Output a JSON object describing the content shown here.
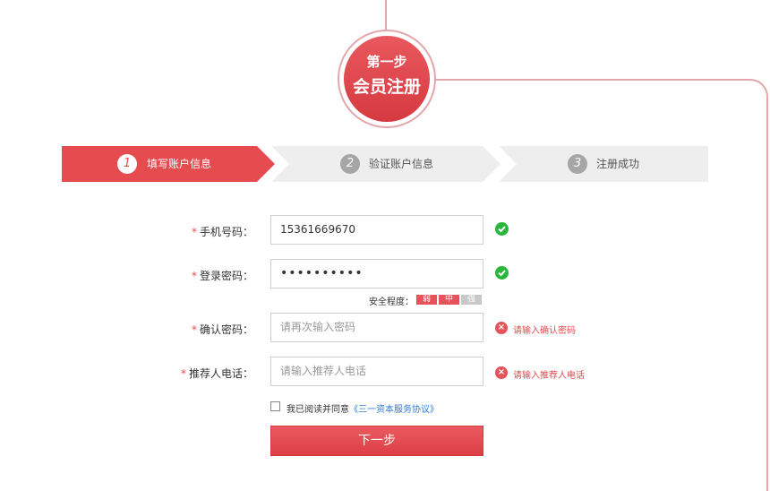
{
  "badge": {
    "line1": "第一步",
    "line2": "会员注册"
  },
  "steps": [
    {
      "number": "1",
      "label": "填写账户信息",
      "active": true
    },
    {
      "number": "2",
      "label": "验证账户信息",
      "active": false
    },
    {
      "number": "3",
      "label": "注册成功",
      "active": false
    }
  ],
  "form": {
    "required_mark": "*",
    "phone": {
      "label": "手机号码：",
      "value": "15361669670"
    },
    "password": {
      "label": "登录密码：",
      "value": "••••••••••"
    },
    "strength": {
      "label": "安全程度：",
      "weak": "弱",
      "medium": "中",
      "strong": "强"
    },
    "confirm": {
      "label": "确认密码：",
      "placeholder": "请再次输入密码",
      "error": "请输入确认密码"
    },
    "referrer": {
      "label": "推荐人电话：",
      "placeholder": "请输入推荐人电话",
      "error": "请输入推荐人电话"
    },
    "agreement": {
      "text": "我已阅读并同意",
      "link": "《三一资本服务协议》"
    },
    "next_button": "下一步"
  },
  "colors": {
    "accent": "#e64b4f",
    "success": "#28b63b",
    "link": "#2b7cd8",
    "step_inactive": "#eeeeee"
  }
}
